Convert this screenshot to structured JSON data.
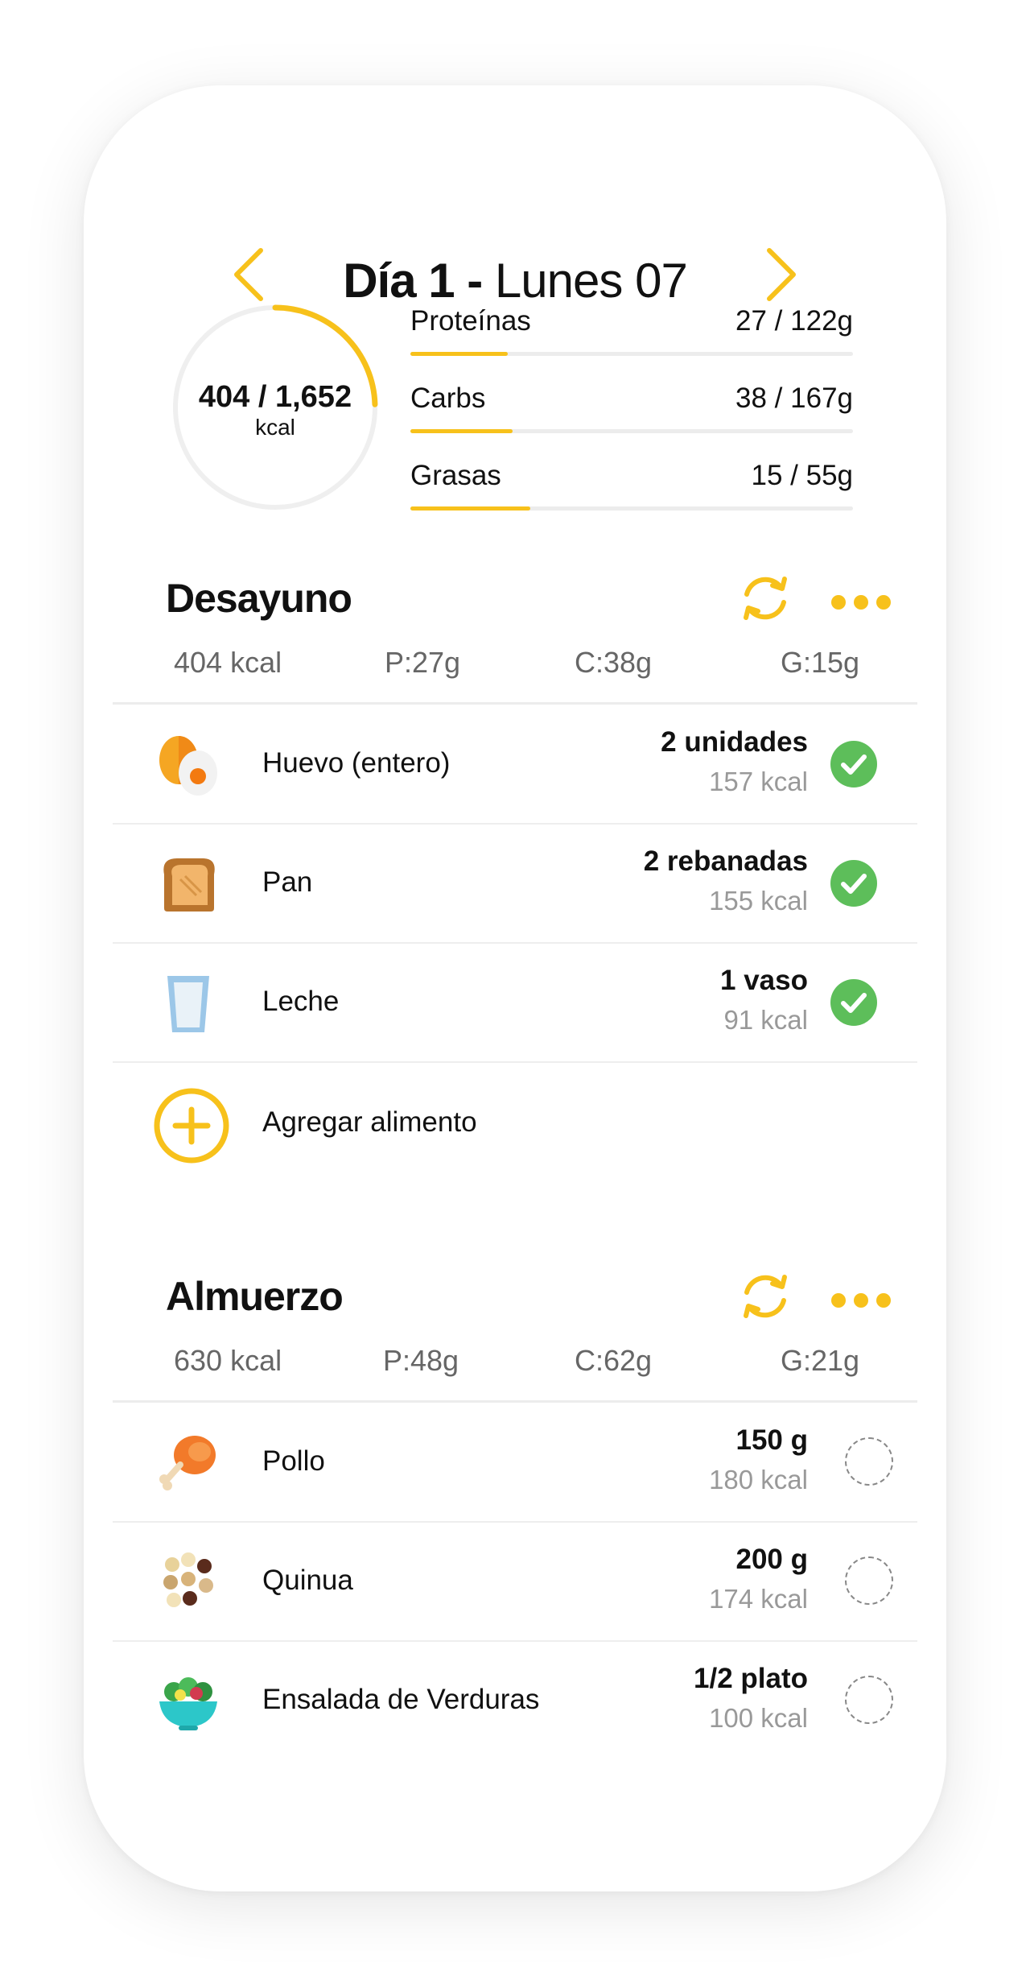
{
  "header": {
    "day_label": "Día 1 -",
    "date_label": "Lunes 07"
  },
  "summary": {
    "calories": "404 / 1,652",
    "calories_unit": "kcal",
    "calories_progress": 0.245,
    "macros": [
      {
        "name": "Proteínas",
        "value": "27 / 122g",
        "progress": 0.22
      },
      {
        "name": "Carbs",
        "value": "38 / 167g",
        "progress": 0.23
      },
      {
        "name": "Grasas",
        "value": "15 / 55g",
        "progress": 0.27
      }
    ]
  },
  "meals": [
    {
      "title": "Desayuno",
      "stats": {
        "kcal": "404 kcal",
        "protein": "P:27g",
        "carbs": "C:38g",
        "fat": "G:15g"
      },
      "foods": [
        {
          "icon": "egg-icon",
          "name": "Huevo (entero)",
          "qty": "2 unidades",
          "kcal": "157 kcal",
          "done": true
        },
        {
          "icon": "bread-icon",
          "name": "Pan",
          "qty": "2 rebanadas",
          "kcal": "155 kcal",
          "done": true
        },
        {
          "icon": "milk-glass-icon",
          "name": "Leche",
          "qty": "1 vaso",
          "kcal": "91 kcal",
          "done": true
        }
      ],
      "add_label": "Agregar alimento"
    },
    {
      "title": "Almuerzo",
      "stats": {
        "kcal": "630 kcal",
        "protein": "P:48g",
        "carbs": "C:62g",
        "fat": "G:21g"
      },
      "foods": [
        {
          "icon": "chicken-leg-icon",
          "name": "Pollo",
          "qty": "150 g",
          "kcal": "180 kcal",
          "done": false
        },
        {
          "icon": "quinoa-icon",
          "name": "Quinua",
          "qty": "200 g",
          "kcal": "174 kcal",
          "done": false
        },
        {
          "icon": "salad-bowl-icon",
          "name": "Ensalada de Verduras",
          "qty": "1/2 plato",
          "kcal": "100 kcal",
          "done": false
        }
      ]
    }
  ],
  "colors": {
    "accent": "#f7c11b",
    "check": "#5dbe5a",
    "muted": "#999999"
  }
}
